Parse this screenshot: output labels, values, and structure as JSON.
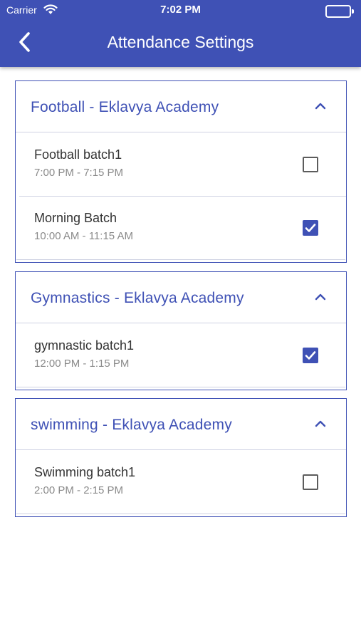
{
  "status_bar": {
    "carrier": "Carrier",
    "time": "7:02 PM"
  },
  "header": {
    "title": "Attendance Settings",
    "back_icon": "chevron-left-icon"
  },
  "colors": {
    "primary": "#3f51b5",
    "divider": "#cfd2e3",
    "text": "#333333",
    "subtext": "#8a8a8a"
  },
  "sections": [
    {
      "title": "Football - Eklavya Academy",
      "expanded": true,
      "batches": [
        {
          "name": "Football batch1",
          "time": "7:00 PM - 7:15 PM",
          "checked": false
        },
        {
          "name": "Morning Batch",
          "time": "10:00 AM - 11:15 AM",
          "checked": true
        }
      ]
    },
    {
      "title": "Gymnastics - Eklavya Academy",
      "expanded": true,
      "batches": [
        {
          "name": "gymnastic batch1",
          "time": "12:00 PM - 1:15 PM",
          "checked": true
        }
      ]
    },
    {
      "title": "swimming - Eklavya Academy",
      "expanded": true,
      "batches": [
        {
          "name": "Swimming batch1",
          "time": "2:00 PM - 2:15 PM",
          "checked": false
        }
      ]
    }
  ]
}
